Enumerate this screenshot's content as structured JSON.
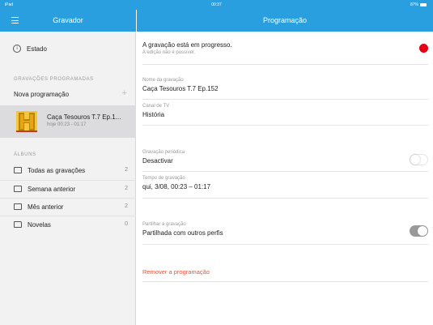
{
  "statusbar": {
    "device": "iPad",
    "time": "00:37",
    "battery": "87%"
  },
  "left_nav": {
    "title": "Gravador"
  },
  "right_nav": {
    "title": "Programação"
  },
  "sidebar": {
    "estado_label": "Estado",
    "scheduled_header": "GRAVAÇÕES PROGRAMADAS",
    "new_schedule_label": "Nova programação",
    "scheduled_items": [
      {
        "title": "Caça Tesouros T.7 Ep.1...",
        "subtitle": "hoje 00:23 - 01:17",
        "channel_logo": "H"
      }
    ],
    "albums_header": "ÁLBUNS",
    "albums": [
      {
        "label": "Todas as gravações",
        "count": "2",
        "icon": "recording-icon"
      },
      {
        "label": "Semana anterior",
        "count": "2",
        "icon": "recording-icon"
      },
      {
        "label": "Mês anterior",
        "count": "2",
        "icon": "recording-icon"
      },
      {
        "label": "Novelas",
        "count": "0",
        "icon": "folder-icon"
      }
    ]
  },
  "main": {
    "recording_status": "A gravação está em progresso.",
    "recording_note": "A edição não é possível.",
    "name_label": "Nome da gravação",
    "name_value": "Caça Tesouros T.7 Ep.152",
    "channel_label": "Canal de TV",
    "channel_value": "História",
    "periodic_label": "Gravação periódica",
    "periodic_value": "Desactivar",
    "time_label": "Tempo de gravação",
    "time_value": "qui, 3/08, 00:23 – 01:17",
    "share_label": "Partilhar a gravação",
    "share_value": "Partilhada com outros perfis",
    "remove_label": "Remover a programação"
  },
  "colors": {
    "accent": "#2a9fe0",
    "record": "#e60012",
    "destructive": "#e8533a"
  }
}
